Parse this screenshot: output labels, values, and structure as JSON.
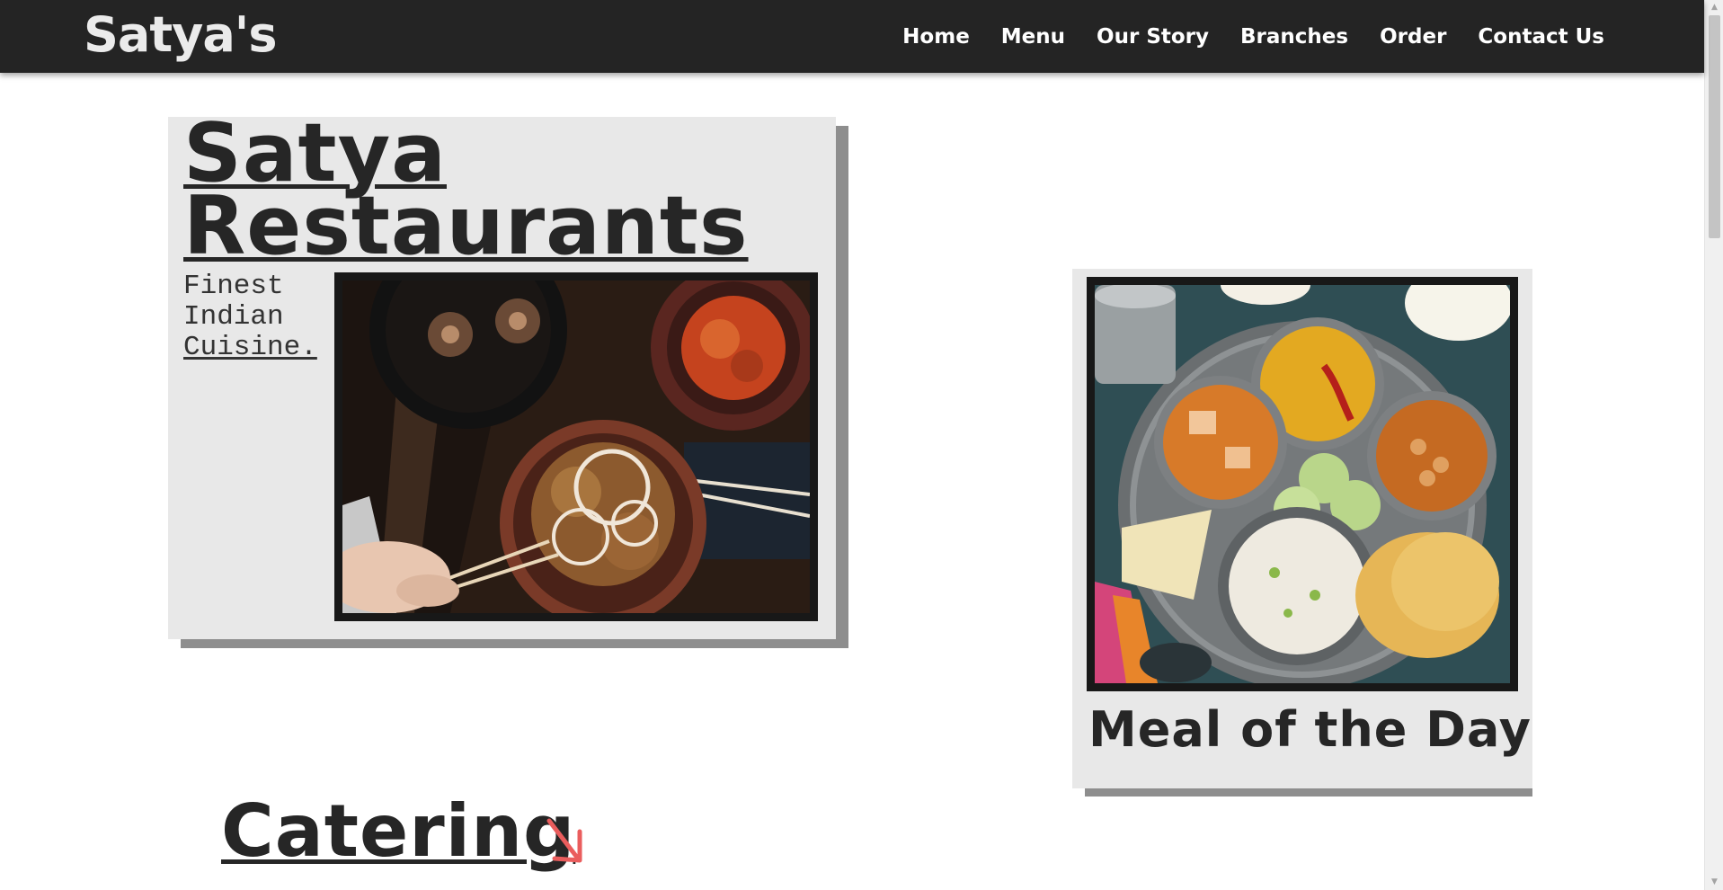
{
  "brand": {
    "name": "Satya's"
  },
  "nav": {
    "items": [
      {
        "label": "Home"
      },
      {
        "label": "Menu"
      },
      {
        "label": "Our Story"
      },
      {
        "label": "Branches"
      },
      {
        "label": "Order"
      },
      {
        "label": "Contact Us"
      }
    ]
  },
  "hero": {
    "title_line1": "Satya",
    "title_line2": "Restaurants",
    "tagline": [
      "Finest",
      "Indian",
      "Cuisine."
    ]
  },
  "meal": {
    "title": "Meal of the Day"
  },
  "catering": {
    "title": "Catering"
  },
  "icons": {
    "arrow": "arrow-down-right-icon",
    "scroll_up": "scroll-up-icon",
    "scroll_down": "scroll-down-icon"
  },
  "colors": {
    "navbar_bg": "#242424",
    "card_bg": "#e8e8e8",
    "card_shadow": "#8e8e8e",
    "heading_text": "#262626",
    "accent_arrow": "#ea5d5d"
  }
}
